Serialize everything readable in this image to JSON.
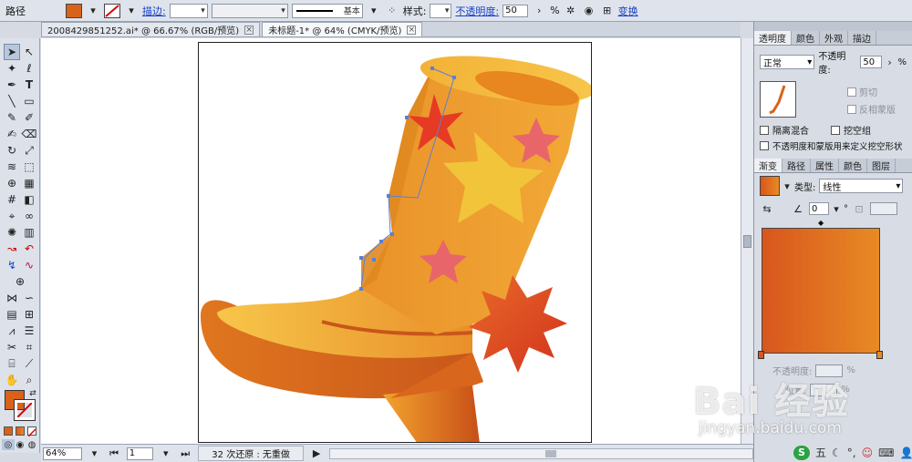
{
  "control_bar": {
    "object_type": "路径",
    "stroke_label": "描边:",
    "stroke_profile": "基本",
    "style_label": "样式:",
    "opacity_label": "不透明度:",
    "opacity_value": "50",
    "opacity_unit": "%",
    "transform_label": "变换"
  },
  "documents": [
    {
      "title": "2008429851252.ai* @ 66.67% (RGB/预览)"
    },
    {
      "title": "未标题-1* @ 64% (CMYK/预览)"
    }
  ],
  "status_bar": {
    "zoom": "64%",
    "artboard_num": "1",
    "undo_info": "32 次还原 : 无重做"
  },
  "transparency_panel": {
    "tabs": [
      "透明度",
      "颜色",
      "外观",
      "描边"
    ],
    "blend_mode": "正常",
    "opacity_label": "不透明度:",
    "opacity_value": "50",
    "opacity_unit": "%",
    "clip_label": "剪切",
    "invert_mask_label": "反相蒙版",
    "isolate_blend_label": "隔离混合",
    "knockout_group_label": "挖空组",
    "opacity_mask_label": "不透明度和蒙版用来定义挖空形状"
  },
  "gradient_panel": {
    "tabs": [
      "渐变",
      "路径",
      "属性",
      "颜色",
      "图层"
    ],
    "type_label": "类型:",
    "type_value": "线性",
    "angle_value": "0",
    "angle_unit": "°",
    "stop_opacity_label": "不透明度:",
    "stop_opacity_unit": "%",
    "location_label": "位置:",
    "location_unit": "%"
  },
  "watermark": {
    "brand": "Bai  经验",
    "url": "jingyan.baidu.com"
  },
  "ime": {
    "label": "五"
  },
  "colors": {
    "fill": "#d9621a",
    "gradient_start": "#d8561d",
    "gradient_end": "#e88a24",
    "boot_light": "#f7c64a",
    "boot_dark": "#e0761f",
    "star_red": "#e63a24",
    "star_pink": "#e8666a",
    "star_yellow": "#f2c43a",
    "selection": "#5b7fd6"
  }
}
